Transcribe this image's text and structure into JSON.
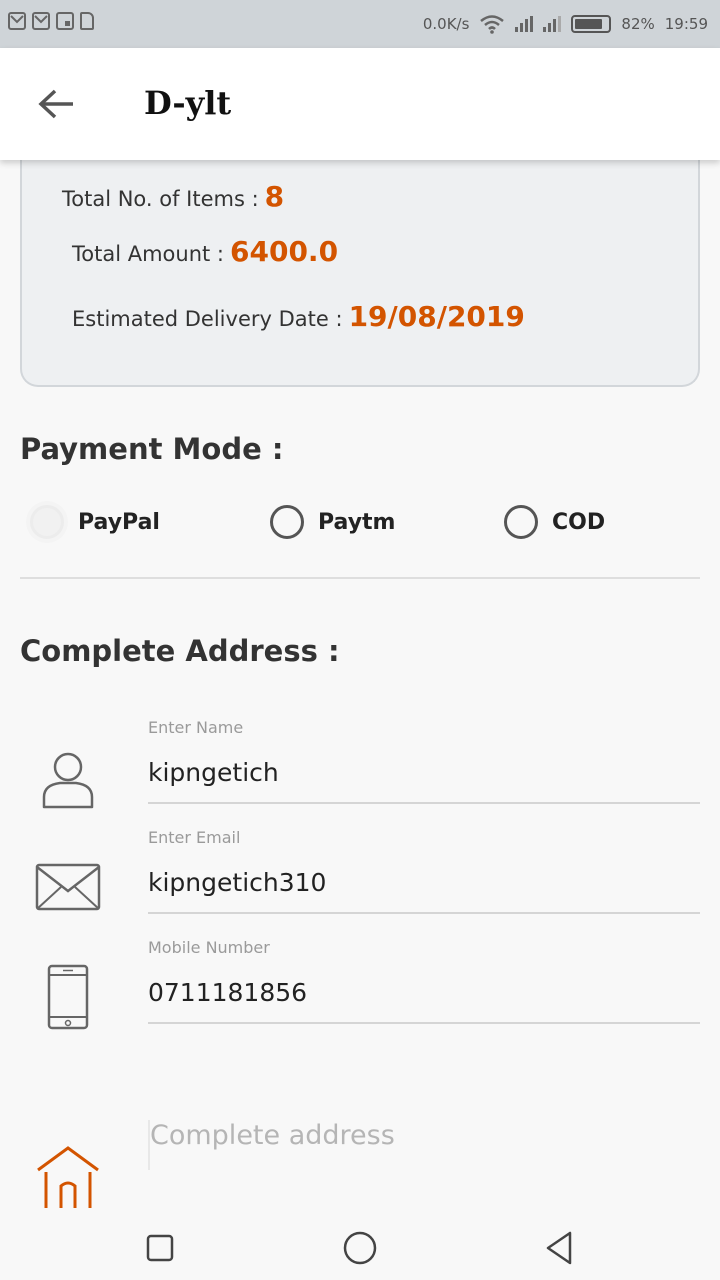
{
  "status_bar": {
    "net_speed": "0.0K/s",
    "battery_percent": "82%",
    "time": "19:59",
    "battery_level": 0.82,
    "icons": [
      "gmail-icon",
      "gmail-icon",
      "gallery-icon",
      "file-icon",
      "wifi-icon",
      "signal-icon",
      "signal-icon",
      "battery-icon"
    ]
  },
  "app_bar": {
    "title": "D-ylt",
    "back_icon": "arrow-left-icon"
  },
  "summary": {
    "items_label": "Total No. of Items :",
    "items_value": "8",
    "amount_label": "Total Amount :",
    "amount_value": "6400.0",
    "delivery_label": "Estimated Delivery Date :",
    "delivery_value": "19/08/2019"
  },
  "payment": {
    "heading": "Payment Mode :",
    "options": [
      {
        "label": "PayPal",
        "selected": true
      },
      {
        "label": "Paytm",
        "selected": false
      },
      {
        "label": "COD",
        "selected": false
      }
    ]
  },
  "address": {
    "heading": "Complete Address :",
    "name_hint": "Enter Name",
    "name_value": "kipngetich",
    "email_hint": "Enter Email",
    "email_value": "kipngetich310",
    "mobile_hint": "Mobile Number",
    "mobile_value": "0711181856",
    "address_placeholder": "Complete address"
  },
  "colors": {
    "accent": "#d35400",
    "status_bar": "#cfd4d8",
    "card_bg": "#eef0f2"
  }
}
